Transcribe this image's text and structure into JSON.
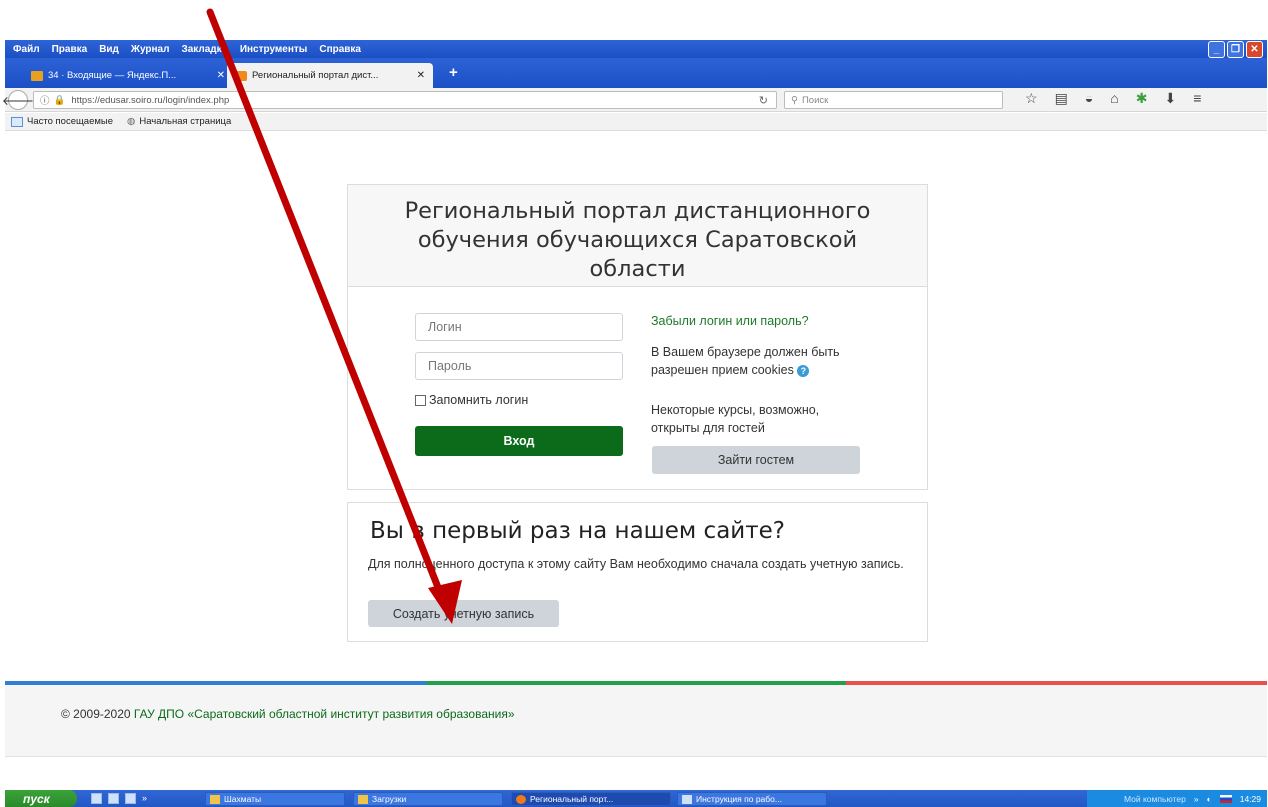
{
  "colors": {
    "accent_green": "#0b6b1a",
    "link_green": "#1f7a2a",
    "arrow_red": "#c00000",
    "footer_line_blue": "#2f7fd6",
    "footer_line_green": "#22a04b",
    "footer_line_red": "#e8504a"
  },
  "browser": {
    "menu": [
      "Файл",
      "Правка",
      "Вид",
      "Журнал",
      "Закладки",
      "Инструменты",
      "Справка"
    ],
    "tabs": [
      {
        "label": "34 · Входящие — Яндекс.П...",
        "icon": "mail-icon"
      },
      {
        "label": "Региональный портал дист...",
        "icon": "moodle-icon"
      }
    ],
    "new_tab": "+",
    "url": "https://edusar.soiro.ru/login/index.php",
    "search_placeholder": "Поиск",
    "bookmarks": [
      "Часто посещаемые",
      "Начальная страница"
    ]
  },
  "login": {
    "title": "Региональный портал дистанционного обучения обучающихся Саратовской области",
    "username_placeholder": "Логин",
    "password_placeholder": "Пароль",
    "remember_label": "Запомнить логин",
    "login_button": "Вход",
    "forgot_link": "Забыли логин или пароль?",
    "cookies_note": "В Вашем браузере должен быть разрешен прием cookies",
    "guest_note": "Некоторые курсы, возможно, открыты для гостей",
    "guest_button": "Зайти гостем"
  },
  "signup": {
    "title": "Вы в первый раз на нашем сайте?",
    "text": "Для полноценного доступа к этому сайту Вам необходимо сначала создать учетную запись.",
    "button": "Создать учетную запись"
  },
  "footer": {
    "copyright": "© 2009-2020",
    "org": "ГАУ ДПО «Саратовский областной институт развития образования»"
  },
  "taskbar": {
    "start": "пуск",
    "tasks": [
      "Шахматы",
      "Загрузки",
      "Региональный порт...",
      "Инструкция по рабо..."
    ],
    "tray_label": "Мой компьютер",
    "time": "14:29"
  }
}
